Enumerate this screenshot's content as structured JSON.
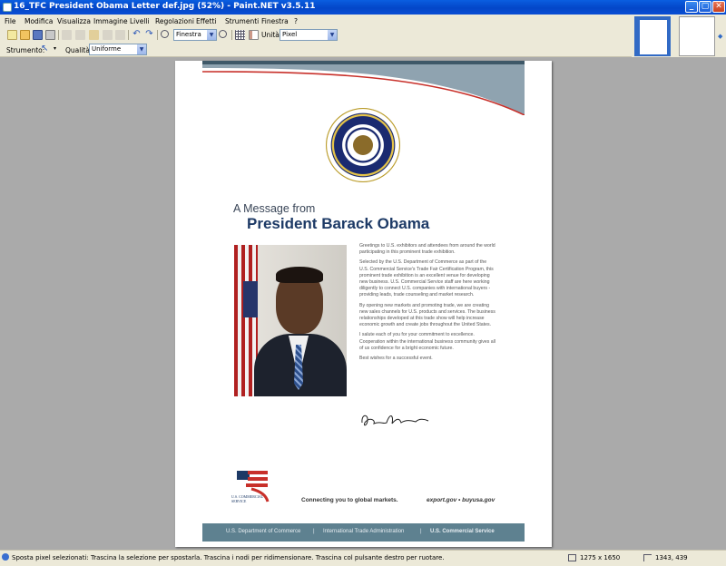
{
  "window": {
    "title": "16_TFC President Obama Letter def.jpg (52%) - Paint.NET v3.5.11",
    "buttons": {
      "minimize": "_",
      "maximize": "▢",
      "close": "✕"
    }
  },
  "menu": {
    "items": [
      "File",
      "Modifica",
      "Visualizza",
      "Immagine",
      "Livelli",
      "Regolazioni",
      "Effetti",
      "Strumenti",
      "Finestra",
      "?"
    ]
  },
  "toolbar": {
    "zoom_value": "Finestra",
    "units_label": "Unità:",
    "units_value": "Pixel",
    "tool_label": "Strumento:",
    "quality_label": "Qualità:",
    "quality_value": "Uniforme"
  },
  "document": {
    "message_from": "A Message from",
    "name": "President Barack Obama",
    "paragraphs": [
      "Greetings to U.S. exhibitors and attendees from around the world participating in this prominent trade exhibition.",
      "Selected by the U.S. Department of Commerce as part of the U.S. Commercial Service's Trade Fair Certification Program, this prominent trade exhibition is an excellent venue for developing new business. U.S. Commercial Service staff are here working diligently to connect U.S. companies with international buyers - providing leads, trade counseling and market research.",
      "By opening new markets and promoting trade, we are creating new sales channels for U.S. products and services. The business relationships developed at this trade show will help increase economic growth and create jobs throughout the United States.",
      "I salute each of you for your commitment to excellence. Cooperation within the international business community gives all of us confidence for a bright economic future.",
      "Best wishes for a successful event."
    ],
    "logo_text": "U.S. COMMERCIAL SERVICE",
    "tagline": "Connecting you to global markets.",
    "site": "export.gov • buyusa.gov",
    "footer": [
      "U.S. Department of Commerce",
      "|",
      "International Trade Administration",
      "|",
      "U.S. Commercial Service"
    ]
  },
  "status": {
    "hint": "Sposta pixel selezionati: Trascina la selezione per spostarla. Trascina i nodi per ridimensionare. Trascina col pulsante destro per ruotare.",
    "image_size": "1275 x 1650",
    "cursor": "1343, 439"
  },
  "colors": {
    "titlebar": "#0346c8",
    "chrome": "#ece9d8",
    "canvas": "#aaaaaa",
    "name_blue": "#1d3a66",
    "footer_band": "#5e8190"
  }
}
